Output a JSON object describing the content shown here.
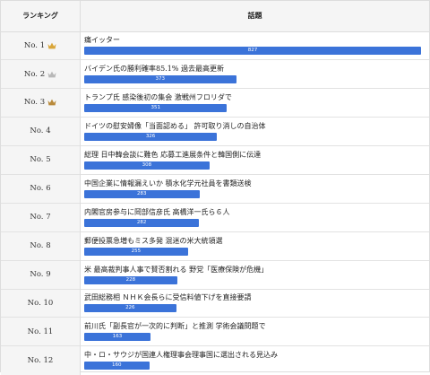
{
  "header": {
    "rank_label": "ランキング",
    "topic_label": "話題"
  },
  "rows": [
    {
      "rank": "No. 1",
      "crown": "gold",
      "title": "痛イッター",
      "count": "827",
      "fraction": 1.0
    },
    {
      "rank": "No. 2",
      "crown": "silver",
      "title": "バイデン氏の勝利確率85.1% 過去最高更新",
      "count": "373",
      "fraction": 0.451
    },
    {
      "rank": "No. 3",
      "crown": "bronze",
      "title": "トランプ氏 感染後初の集会 激戦州フロリダで",
      "count": "351",
      "fraction": 0.424
    },
    {
      "rank": "No. 4",
      "crown": null,
      "title": "ドイツの慰安婦像「当面認める」 許可取り消しの自治体",
      "count": "326",
      "fraction": 0.394
    },
    {
      "rank": "No. 5",
      "crown": null,
      "title": "総理 日中韓会談に難色 応募工進展条件と韓国側に伝達",
      "count": "308",
      "fraction": 0.372
    },
    {
      "rank": "No. 6",
      "crown": null,
      "title": "中国企業に情報漏えいか 積水化学元社員を書類送検",
      "count": "283",
      "fraction": 0.342
    },
    {
      "rank": "No. 7",
      "crown": null,
      "title": "内閣官房参与に岡部信彦氏 高橋洋一氏ら６人",
      "count": "282",
      "fraction": 0.341
    },
    {
      "rank": "No. 8",
      "crown": null,
      "title": "郵便投票急増もミス多発 混迷の米大統領選",
      "count": "255",
      "fraction": 0.308
    },
    {
      "rank": "No. 9",
      "crown": null,
      "title": "米 最高裁判事人事で賛否割れる 野党「医療保険が危機」",
      "count": "228",
      "fraction": 0.276
    },
    {
      "rank": "No. 10",
      "crown": null,
      "title": "武田総務相 ＮＨＫ会長らに受信料値下げを直接要請",
      "count": "226",
      "fraction": 0.273
    },
    {
      "rank": "No. 11",
      "crown": null,
      "title": "前川氏「副長官が一次的に判断」と推測 学術会議問題で",
      "count": "163",
      "fraction": 0.197
    },
    {
      "rank": "No. 12",
      "crown": null,
      "title": "中・ロ・サウジが国連人権理事会理事国に選出される見込み",
      "count": "160",
      "fraction": 0.193
    }
  ],
  "colors": {
    "bar": "#3b73d9",
    "gold": "#d9a63a",
    "silver": "#b8b8b8",
    "bronze": "#b98a3c"
  }
}
